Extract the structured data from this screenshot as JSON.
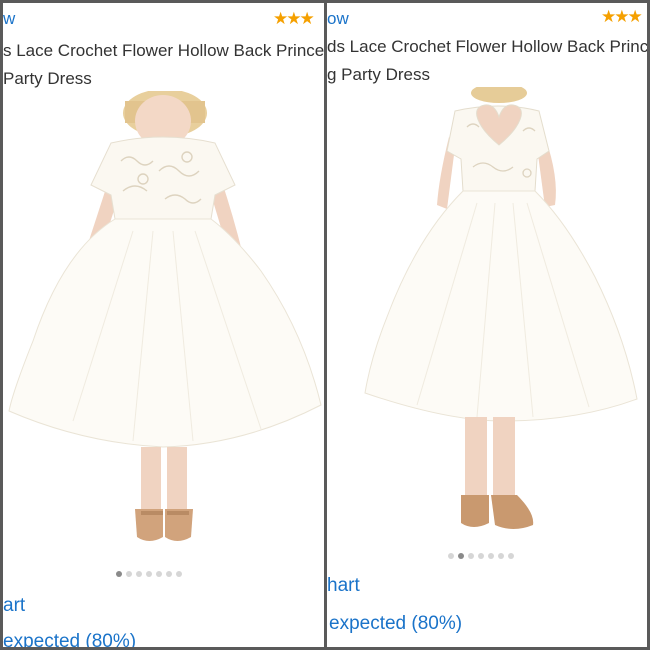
{
  "left": {
    "link_fragment": "w",
    "rating_stars": "★★★",
    "title_line1": "s Lace Crochet Flower Hollow Back Princess",
    "title_line2": "Party Dress",
    "carousel": {
      "count": 7,
      "active_index": 0
    },
    "cart_fragment": "art",
    "expected_fragment": "expected (80%)"
  },
  "right": {
    "link_fragment": "ow",
    "rating_stars": "★★★",
    "title_line1": "ds Lace Crochet Flower Hollow Back Princess",
    "title_line2": "g Party Dress",
    "carousel": {
      "count": 7,
      "active_index": 1
    },
    "cart_fragment": "hart",
    "expected_fragment": "expected (80%)"
  },
  "colors": {
    "link_blue": "#1a73c9",
    "star_gold": "#f5a000",
    "divider": "#5a5a5a"
  }
}
